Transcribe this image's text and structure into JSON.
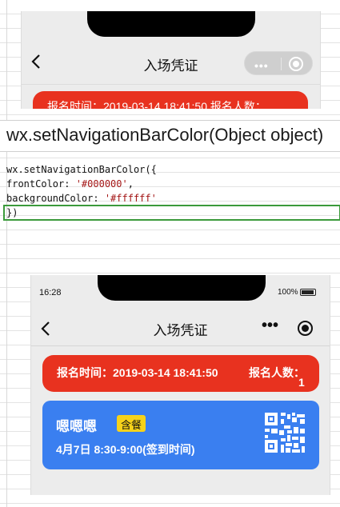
{
  "top_screenshot": {
    "nav_title": "入场凭证",
    "capsule_dots": "•••",
    "banner_text": "报名时间：2019-03-14 18:41:50    报名人数："
  },
  "doc": {
    "heading": "wx.setNavigationBarColor(Object object)",
    "code": {
      "line1": "wx.setNavigationBarColor({",
      "line2_key": "frontColor: ",
      "line2_val": "'#000000'",
      "line2_end": ",",
      "line3_key": "backgroundColor: ",
      "line3_val": "'#ffffff'",
      "line4": "})"
    }
  },
  "bottom_screenshot": {
    "status_time": "16:28",
    "battery": "100%",
    "nav_title": "入场凭证",
    "more": "•••",
    "banner": {
      "time_label": "报名时间：2019-03-14 18:41:50",
      "count_label": "报名人数：",
      "count_value": "1"
    },
    "card": {
      "name": "嗯嗯嗯",
      "tag": "含餐",
      "date": "4月7日 8:30-9:00(签到时间)"
    }
  },
  "colors": {
    "banner_red": "#e8321f",
    "card_blue": "#3a7ff0",
    "tag_yellow": "#f6d21a",
    "string_literal": "#a31515",
    "selection_green": "#3b9a3b"
  },
  "icons": [
    "back-arrow-icon",
    "more-dots-icon",
    "target-icon",
    "qr-code-icon",
    "battery-icon"
  ]
}
